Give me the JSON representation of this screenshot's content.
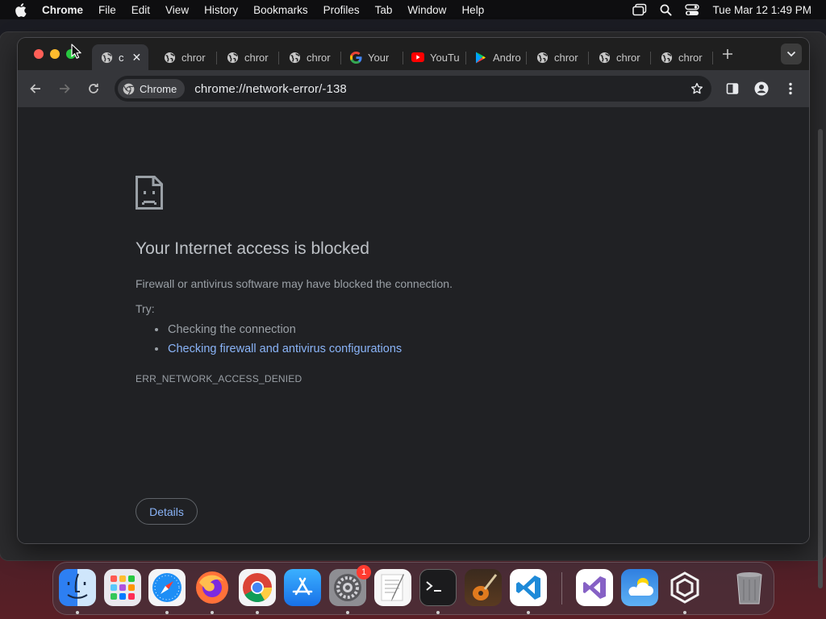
{
  "menubar": {
    "app_name": "Chrome",
    "items": [
      "File",
      "Edit",
      "View",
      "History",
      "Bookmarks",
      "Profiles",
      "Tab",
      "Window",
      "Help"
    ],
    "clock": "Tue Mar 12  1:49 PM"
  },
  "tabs": [
    {
      "title": "c",
      "icon": "globe-icon",
      "active": true
    },
    {
      "title": "chror",
      "icon": "globe-icon"
    },
    {
      "title": "chror",
      "icon": "globe-icon"
    },
    {
      "title": "chror",
      "icon": "globe-icon"
    },
    {
      "title": "Your",
      "icon": "google-icon"
    },
    {
      "title": "YouTu",
      "icon": "youtube-icon"
    },
    {
      "title": "Andro",
      "icon": "play-store-icon"
    },
    {
      "title": "chror",
      "icon": "globe-icon"
    },
    {
      "title": "chror",
      "icon": "globe-icon"
    },
    {
      "title": "chror",
      "icon": "globe-icon"
    }
  ],
  "toolbar": {
    "chip_label": "Chrome",
    "url": "chrome://network-error/-138"
  },
  "error": {
    "title": "Your Internet access is blocked",
    "description": "Firewall or antivirus software may have blocked the connection.",
    "try_label": "Try:",
    "suggestions": [
      "Checking the connection",
      "Checking firewall and antivirus configurations"
    ],
    "code": "ERR_NETWORK_ACCESS_DENIED",
    "details_button": "Details"
  },
  "dock": {
    "apps": [
      "finder-icon",
      "launchpad-icon",
      "safari-icon",
      "firefox-icon",
      "chrome-icon",
      "app-store-icon",
      "system-settings-icon",
      "textedit-icon",
      "terminal-icon",
      "garageband-icon",
      "vscode-icon",
      "visual-studio-icon",
      "weather-icon",
      "vmware-icon",
      "trash-icon"
    ],
    "settings_badge": "1"
  },
  "colors": {
    "link": "#8ab4f8",
    "page_bg": "#202124",
    "toolbar_bg": "#35363a"
  }
}
